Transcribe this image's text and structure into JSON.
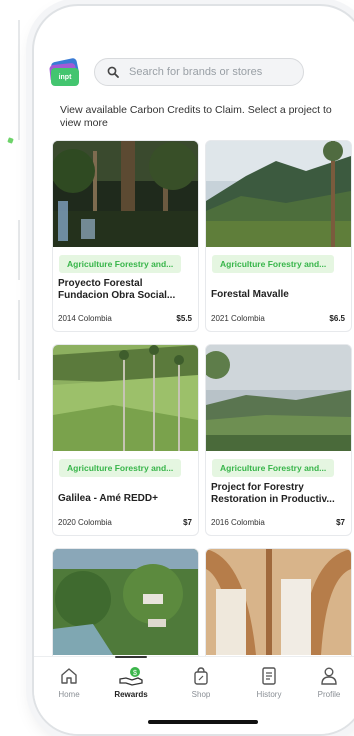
{
  "app": {
    "logo_text": "inpt"
  },
  "search": {
    "placeholder": "Search for brands or stores"
  },
  "intro_text": "View available Carbon Credits to Claim. Select a project to view more",
  "projects": [
    {
      "category": "Agriculture Forestry and...",
      "title": "Proyecto Forestal Fundacion Obra Social...",
      "year_country": "2014 Colombia",
      "price": "$5.5"
    },
    {
      "category": "Agriculture Forestry and...",
      "title": "Forestal Mavalle",
      "year_country": "2021 Colombia",
      "price": "$6.5"
    },
    {
      "category": "Agriculture Forestry and...",
      "title": "Galilea - Amé REDD+",
      "year_country": "2020 Colombia",
      "price": "$7"
    },
    {
      "category": "Agriculture Forestry and...",
      "title": "Project for Forestry Restoration in Productiv...",
      "year_country": "2016 Colombia",
      "price": "$7"
    },
    {
      "category": "",
      "title": "",
      "year_country": "",
      "price": ""
    },
    {
      "category": "",
      "title": "",
      "year_country": "",
      "price": ""
    }
  ],
  "nav": {
    "items": [
      {
        "label": "Home",
        "icon": "home-icon"
      },
      {
        "label": "Rewards",
        "icon": "rewards-icon",
        "active": true
      },
      {
        "label": "Shop",
        "icon": "shop-icon"
      },
      {
        "label": "History",
        "icon": "history-icon"
      },
      {
        "label": "Profile",
        "icon": "profile-icon"
      }
    ]
  },
  "colors": {
    "accent_green": "#38b54a",
    "chip_bg": "#e5f6e1"
  }
}
